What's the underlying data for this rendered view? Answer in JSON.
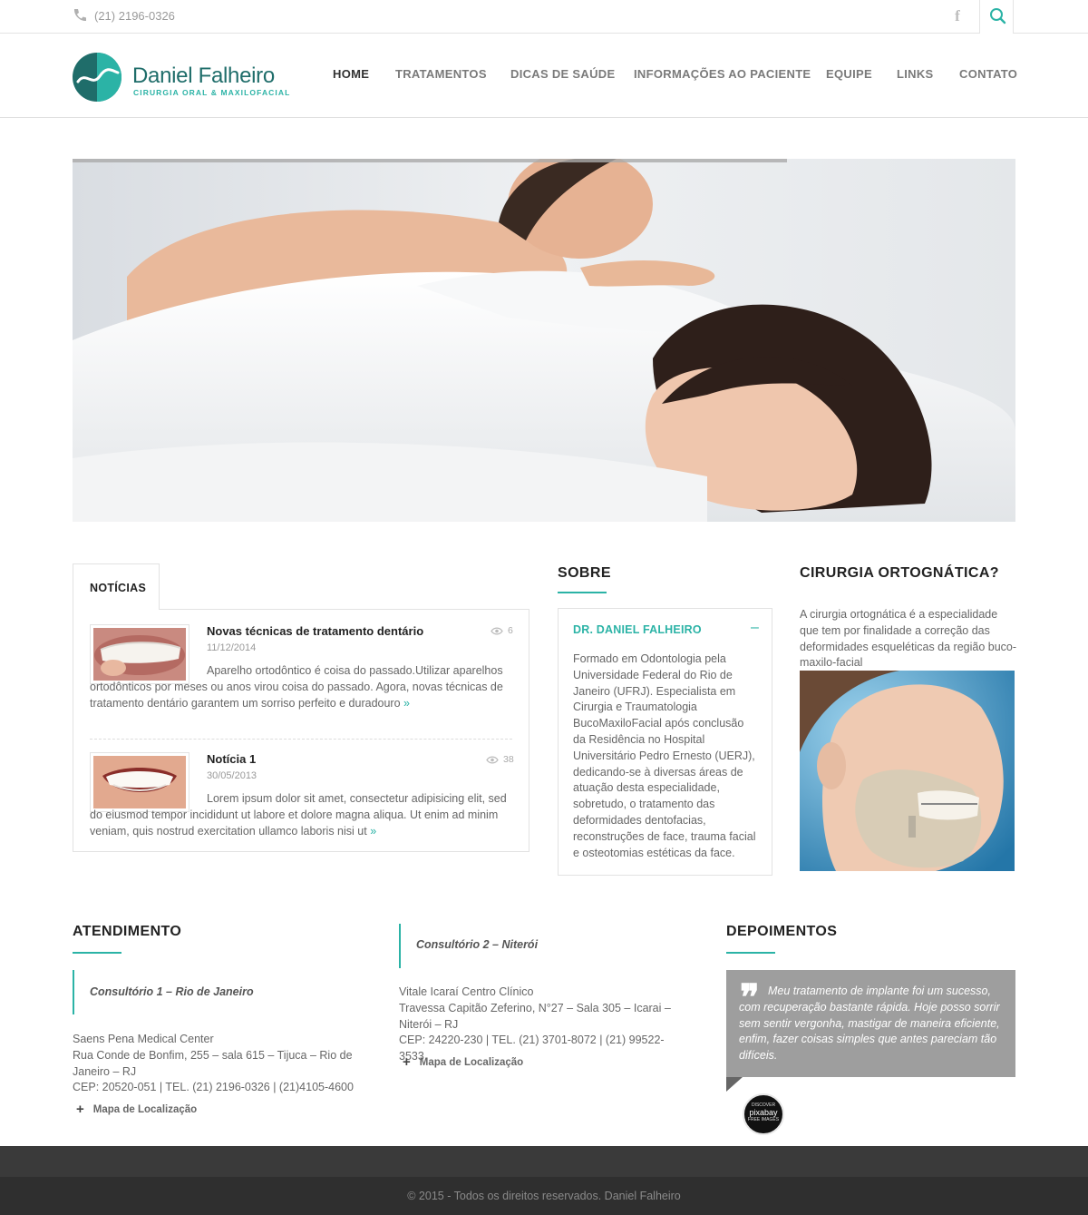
{
  "topbar": {
    "phone": "(21) 2196-0326",
    "social_icon": "facebook-icon",
    "search_icon": "search-icon"
  },
  "logo": {
    "name": "Daniel Falheiro",
    "subtitle": "CIRURGIA ORAL & MAXILOFACIAL"
  },
  "nav": {
    "items": [
      "HOME",
      "TRATAMENTOS",
      "DICAS DE SAÚDE",
      "INFORMAÇÕES AO PACIENTE",
      "EQUIPE",
      "LINKS",
      "CONTATO"
    ],
    "active": "HOME"
  },
  "news": {
    "tab": "NOTÍCIAS",
    "items": [
      {
        "title": "Novas técnicas de tratamento dentário",
        "date": "11/12/2014",
        "views": "6",
        "text": "Aparelho ortodôntico é coisa do passado.Utilizar aparelhos ortodônticos por meses ou anos virou coisa do passado. Agora, novas técnicas de tratamento dentário garantem um sorriso perfeito e duradouro",
        "more": "»"
      },
      {
        "title": "Notícia 1",
        "date": "30/05/2013",
        "views": "38",
        "text": "Lorem ipsum dolor sit amet, consectetur adipisicing elit, sed do eiusmod tempor incididunt ut labore et dolore magna aliqua. Ut enim ad minim veniam, quis nostrud exercitation ullamco laboris nisi ut",
        "more": "»"
      }
    ]
  },
  "sobre": {
    "title": "SOBRE",
    "name": "DR. DANIEL FALHEIRO",
    "toggle": "–",
    "text": "Formado em Odontologia pela Universidade Federal do Rio de Janeiro (UFRJ). Especialista em Cirurgia e Traumatologia BucoMaxiloFacial após conclusão da Residência no Hospital Universitário Pedro Ernesto (UERJ), dedicando-se à diversas áreas de atuação desta especialidade, sobretudo, o tratamento das deformidades dentofacias, reconstruções de face, trauma facial e osteotomias estéticas da face."
  },
  "orto": {
    "title": "CIRURGIA ORTOGNÁTICA?",
    "text": "A cirurgia ortognática é a especialidade que tem por finalidade a correção das deformidades esqueléticas da região buco-maxilo-facial"
  },
  "atendimento": {
    "title": "ATENDIMENTO",
    "offices": [
      {
        "name": "Consultório 1 – Rio de Janeiro",
        "lines": [
          "Saens Pena Medical Center",
          "Rua Conde de Bonfim, 255 – sala 615 – Tijuca – Rio de Janeiro – RJ",
          "CEP: 20520-051 | TEL. (21) 2196-0326 | (21)4105-4600"
        ],
        "map": "Mapa de Localização"
      },
      {
        "name": "Consultório 2 – Niterói",
        "lines": [
          "Vitale Icaraí Centro Clínico",
          "Travessa Capitão Zeferino, N°27 – Sala 305 – Icarai – Niterói – RJ",
          "CEP: 24220-230 | TEL. (21) 3701-8072 | (21) 99522-3533"
        ],
        "map": "Mapa de Localização"
      }
    ]
  },
  "depoimentos": {
    "title": "DEPOIMENTOS",
    "quote_mark": "❞",
    "text": "Meu tratamento de implante foi um sucesso, com recuperação bastante rápida. Hoje posso sorrir sem sentir vergonha, mastigar de maneira eficiente, enfim, fazer coisas simples que antes pareciam tão difíceis.",
    "avatar_line1": "DISCOVER",
    "avatar_line2": "pixabay",
    "avatar_line3": "FREE IMAGES"
  },
  "footer": {
    "copyright": "© 2015 - Todos os direitos reservados. Daniel Falheiro"
  }
}
